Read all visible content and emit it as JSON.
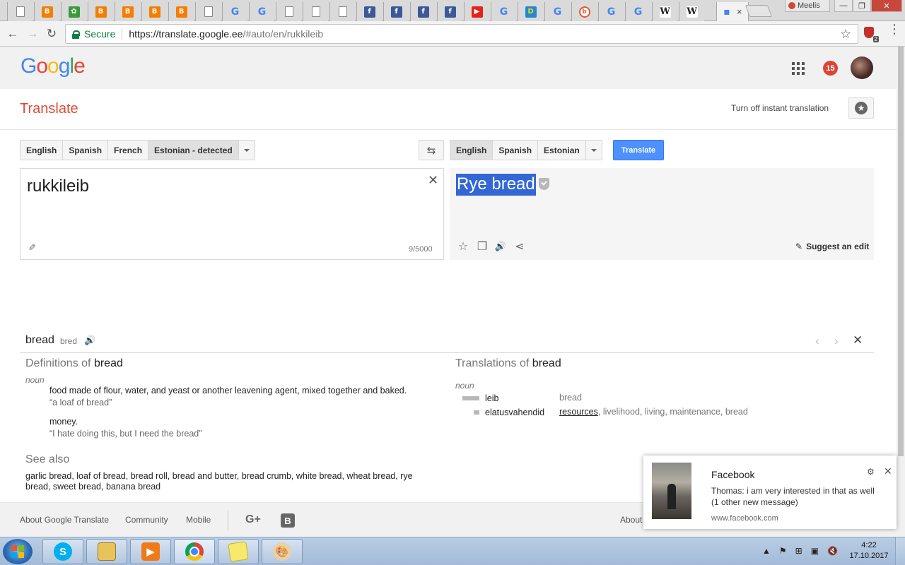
{
  "browser": {
    "tabs": [
      {
        "icon": "doc-icon",
        "glyph": ""
      },
      {
        "icon": "blogger-icon",
        "glyph": "B"
      },
      {
        "icon": "green-app-icon",
        "glyph": "✿"
      },
      {
        "icon": "blogger-icon",
        "glyph": "B"
      },
      {
        "icon": "blogger-icon",
        "glyph": "B"
      },
      {
        "icon": "blogger-icon",
        "glyph": "B"
      },
      {
        "icon": "blogger-icon",
        "glyph": "B"
      },
      {
        "icon": "doc-icon",
        "glyph": ""
      },
      {
        "icon": "google-icon",
        "glyph": "G"
      },
      {
        "icon": "google-icon",
        "glyph": "G"
      },
      {
        "icon": "doc-icon",
        "glyph": ""
      },
      {
        "icon": "doc-icon",
        "glyph": ""
      },
      {
        "icon": "doc-icon",
        "glyph": ""
      },
      {
        "icon": "facebook-icon",
        "glyph": "f"
      },
      {
        "icon": "facebook-icon",
        "glyph": "f"
      },
      {
        "icon": "facebook-icon",
        "glyph": "f"
      },
      {
        "icon": "facebook-icon",
        "glyph": "f"
      },
      {
        "icon": "youtube-icon",
        "glyph": "▶"
      },
      {
        "icon": "google-icon",
        "glyph": "G"
      },
      {
        "icon": "d-icon",
        "glyph": "D"
      },
      {
        "icon": "google-icon",
        "glyph": "G"
      },
      {
        "icon": "gplus-icon",
        "glyph": "b"
      },
      {
        "icon": "google-icon",
        "glyph": "G"
      },
      {
        "icon": "google-icon",
        "glyph": "G"
      },
      {
        "icon": "wikipedia-icon",
        "glyph": "W"
      },
      {
        "icon": "wikipedia-icon",
        "glyph": "W"
      }
    ],
    "active_tab": {
      "icon": "google-translate-icon",
      "glyph": "",
      "close": "×"
    },
    "profile_name": "Meelis",
    "window_controls": {
      "minimize": "—",
      "restore": "❐",
      "close": "✕"
    },
    "back": "←",
    "forward": "→",
    "reload": "↻",
    "secure_label": "Secure",
    "url_host": "https://translate.google.ee",
    "url_rest": "/#auto/en/rukkileib",
    "bookmark_star": "☆",
    "extension_count": "2",
    "menu": "⋮"
  },
  "google_header": {
    "logo_letters": [
      {
        "char": "G",
        "color": "#4285f4"
      },
      {
        "char": "o",
        "color": "#ea4335"
      },
      {
        "char": "o",
        "color": "#fbbc05"
      },
      {
        "char": "g",
        "color": "#4285f4"
      },
      {
        "char": "l",
        "color": "#34a853"
      },
      {
        "char": "e",
        "color": "#ea4335"
      }
    ],
    "notification_count": "15"
  },
  "translate": {
    "title": "Translate",
    "instant_toggle": "Turn off instant translation",
    "phrasebook_icon": "★",
    "source_langs": [
      "English",
      "Spanish",
      "French",
      "Estonian - detected"
    ],
    "target_langs": [
      "English",
      "Spanish",
      "Estonian"
    ],
    "swap_icon": "⇆",
    "translate_button": "Translate",
    "source_text": "rukkileib",
    "clear_icon": "✕",
    "handwriting_icon": "✎",
    "char_count": "9/5000",
    "result_text": "Rye bread",
    "result_icons": {
      "star": "☆",
      "copy": "❐",
      "listen": "🔊",
      "share": "⋖"
    },
    "suggest_edit": "Suggest an edit",
    "suggest_icon": "✎"
  },
  "dictionary": {
    "word": "bread",
    "phonetic": "bred",
    "speaker_icon": "🔊",
    "prev": "‹",
    "next": "›",
    "close": "✕",
    "definitions_title_prefix": "Definitions of",
    "definitions_title_word": "bread",
    "definitions_pos": "noun",
    "definitions": [
      {
        "text": "food made of flour, water, and yeast or another leavening agent, mixed together and baked.",
        "example": "“a loaf of bread”"
      },
      {
        "text": "money.",
        "example": "“I hate doing this, but I need the bread”"
      }
    ],
    "see_also_title": "See also",
    "see_also": "garlic bread, loaf of bread, bread roll, bread and butter, bread crumb, white bread, wheat bread, rye bread, sweet bread, banana bread",
    "translations_title_prefix": "Translations of",
    "translations_title_word": "bread",
    "translations_pos": "noun",
    "translations": [
      {
        "word": "leib",
        "synonym_link": "",
        "synonyms": "bread",
        "frequency": 1.0
      },
      {
        "word": "elatusvahendid",
        "synonym_link": "resources",
        "synonyms": ", livelihood, living, maintenance, bread",
        "frequency": 0.33
      }
    ]
  },
  "footer": {
    "links": [
      "About Google Translate",
      "Community",
      "Mobile"
    ],
    "gplus": "G+",
    "blogger": "B",
    "about_right": "About"
  },
  "notification": {
    "title": "Facebook",
    "message": "Thomas: i am very interested in that as well (1 other new message)",
    "source": "www.facebook.com",
    "gear": "⚙",
    "close": "✕"
  },
  "taskbar": {
    "apps": [
      {
        "name": "skype-icon",
        "glyph": "S"
      },
      {
        "name": "file-explorer-icon",
        "glyph": ""
      },
      {
        "name": "media-player-icon",
        "glyph": "▶"
      },
      {
        "name": "chrome-icon",
        "glyph": ""
      },
      {
        "name": "sticky-notes-icon",
        "glyph": ""
      },
      {
        "name": "paint-icon",
        "glyph": "🎨"
      }
    ],
    "tray_icons": [
      "▲",
      "⚑",
      "⊞",
      "▣",
      "🔇"
    ],
    "time": "4:22",
    "date": "17.10.2017"
  }
}
